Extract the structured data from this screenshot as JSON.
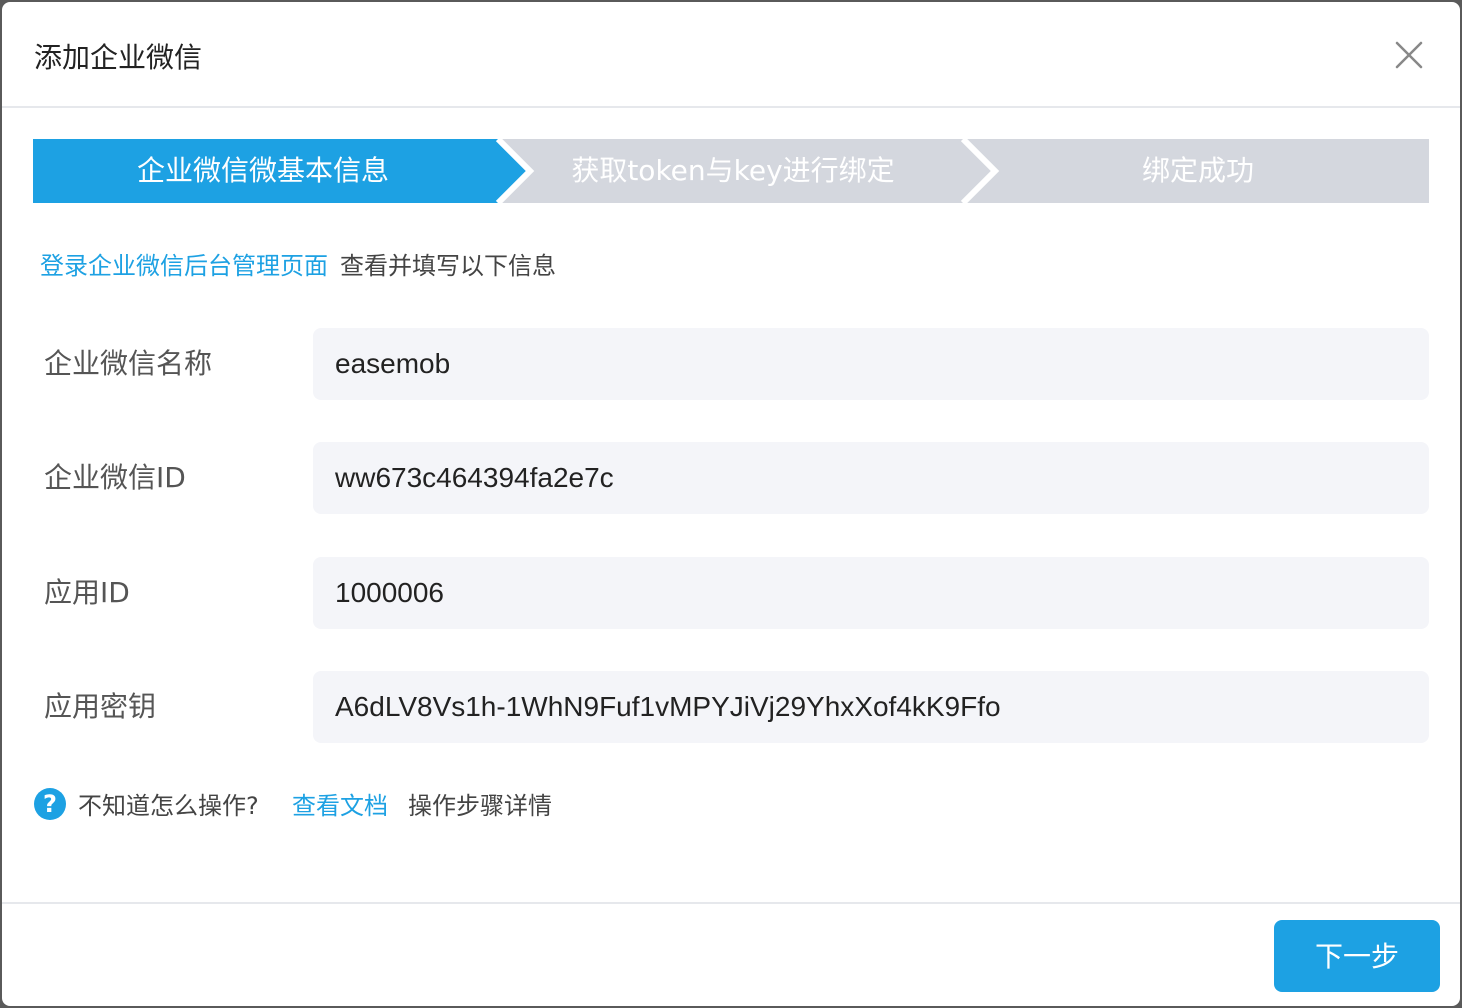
{
  "dialog": {
    "title": "添加企业微信"
  },
  "steps": [
    {
      "label": "企业微信微基本信息",
      "active": true
    },
    {
      "label": "获取token与key进行绑定",
      "active": false
    },
    {
      "label": "绑定成功",
      "active": false
    }
  ],
  "hint": {
    "link": "登录企业微信后台管理页面",
    "text": "查看并填写以下信息"
  },
  "form": {
    "fields": [
      {
        "label": "企业微信名称",
        "value": "easemob"
      },
      {
        "label": "企业微信ID",
        "value": "ww673c464394fa2e7c"
      },
      {
        "label": "应用ID",
        "value": "1000006"
      },
      {
        "label": "应用密钥",
        "value": "A6dLV8Vs1h-1WhN9Fuf1vMPYJiVj29YhxXof4kK9Ffo"
      }
    ]
  },
  "help": {
    "icon": "question-circle-icon",
    "question": "不知道怎么操作?",
    "doc_link": "查看文档",
    "detail": "操作步骤详情"
  },
  "footer": {
    "next_label": "下一步"
  },
  "colors": {
    "accent": "#1da1e3",
    "step_inactive": "#d4d7de",
    "input_bg": "#f4f5f9"
  }
}
